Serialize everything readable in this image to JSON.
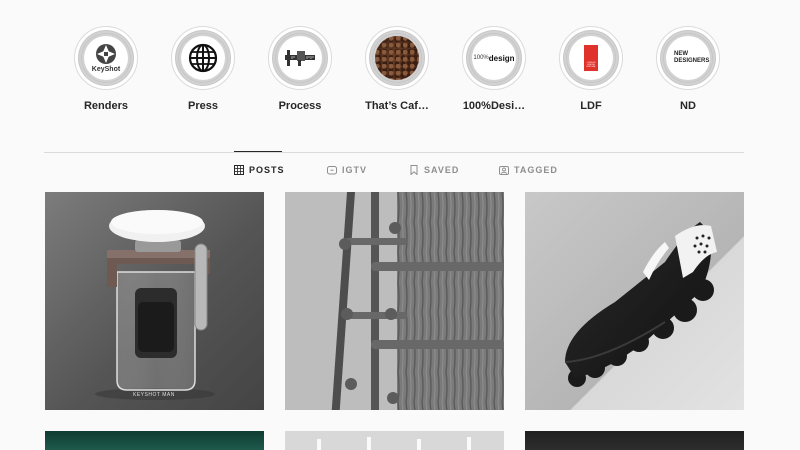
{
  "highlights": [
    {
      "label": "Renders",
      "cover": "keyshot-logo",
      "cover_text": "KeyShot"
    },
    {
      "label": "Press",
      "cover": "globe-icon"
    },
    {
      "label": "Process",
      "cover": "caliper-icon"
    },
    {
      "label": "That’s Caf…",
      "cover": "coffee-beans"
    },
    {
      "label": "100%Desi…",
      "cover": "100design-logo",
      "cover_text_a": "100%",
      "cover_text_b": "design"
    },
    {
      "label": "LDF",
      "cover": "ldf-logo",
      "cover_text": "LONDON DESIGN FESTIVAL"
    },
    {
      "label": "ND",
      "cover": "new-designers-logo",
      "cover_text_a": "NEW",
      "cover_text_b": "DESIGNERS"
    }
  ],
  "tabs": [
    {
      "label": "POSTS",
      "icon": "grid-icon",
      "active": true
    },
    {
      "label": "IGTV",
      "icon": "igtv-icon",
      "active": false
    },
    {
      "label": "SAVED",
      "icon": "bookmark-icon",
      "active": false
    },
    {
      "label": "TAGGED",
      "icon": "tag-icon",
      "active": false
    }
  ],
  "posts": [
    {
      "subject": "coffee press render",
      "caption": "KEYSHOT MAN"
    },
    {
      "subject": "coat rack on tree bark"
    },
    {
      "subject": "sneaker render"
    },
    {
      "subject": "dark green post"
    },
    {
      "subject": "light grey post"
    },
    {
      "subject": "dark post"
    }
  ],
  "colors": {
    "background": "#fafafa",
    "text": "#262626",
    "muted": "#8e8e8e",
    "border": "#dbdbdb",
    "ldf_red": "#e0322a"
  }
}
